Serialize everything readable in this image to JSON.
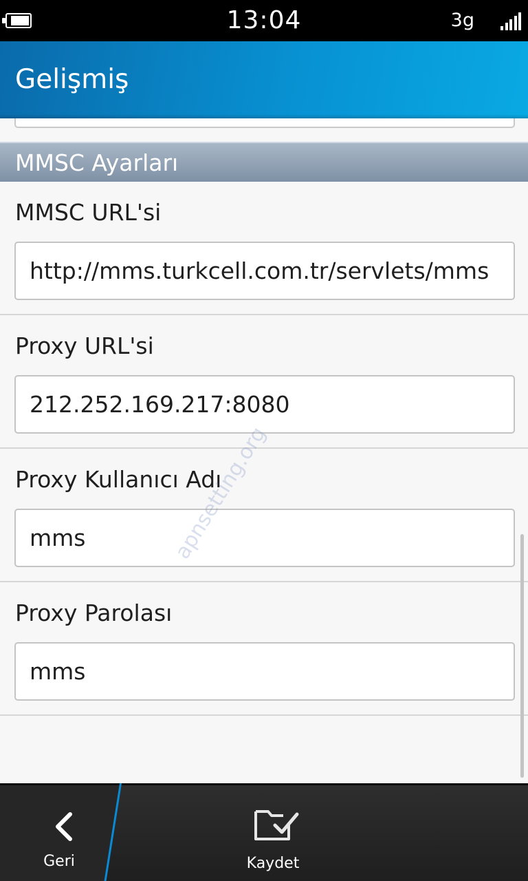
{
  "status_bar": {
    "time": "13:04",
    "network": "3g",
    "battery_level": 0.85,
    "signal_bars": 5
  },
  "header": {
    "title": "Gelişmiş"
  },
  "section": {
    "title": "MMSC Ayarları"
  },
  "fields": [
    {
      "label": "MMSC URL'si",
      "value": "http://mms.turkcell.com.tr/servlets/mms"
    },
    {
      "label": "Proxy URL'si",
      "value": "212.252.169.217:8080"
    },
    {
      "label": "Proxy Kullanıcı Adı",
      "value": "mms"
    },
    {
      "label": "Proxy Parolası",
      "value": "mms"
    }
  ],
  "watermark": "apnsetting.org",
  "action_bar": {
    "back_label": "Geri",
    "save_label": "Kaydet"
  },
  "colors": {
    "accent": "#0891d2",
    "section_header": "#8d9db0",
    "action_bar": "#262626"
  },
  "icons": {
    "back": "chevron-left-icon",
    "save": "folder-check-icon",
    "battery": "battery-icon",
    "signal": "signal-bars-icon"
  }
}
